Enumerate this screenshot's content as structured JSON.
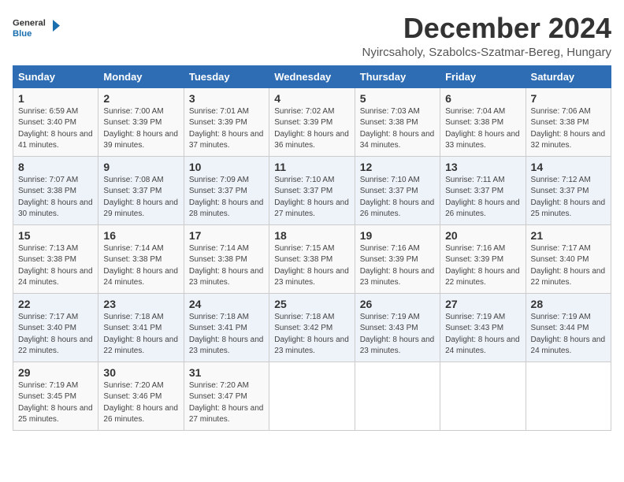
{
  "logo": {
    "general": "General",
    "blue": "Blue"
  },
  "title": "December 2024",
  "location": "Nyircsaholy, Szabolcs-Szatmar-Bereg, Hungary",
  "days_of_week": [
    "Sunday",
    "Monday",
    "Tuesday",
    "Wednesday",
    "Thursday",
    "Friday",
    "Saturday"
  ],
  "weeks": [
    [
      {
        "day": "1",
        "sunrise": "6:59 AM",
        "sunset": "3:40 PM",
        "daylight": "8 hours and 41 minutes."
      },
      {
        "day": "2",
        "sunrise": "7:00 AM",
        "sunset": "3:39 PM",
        "daylight": "8 hours and 39 minutes."
      },
      {
        "day": "3",
        "sunrise": "7:01 AM",
        "sunset": "3:39 PM",
        "daylight": "8 hours and 37 minutes."
      },
      {
        "day": "4",
        "sunrise": "7:02 AM",
        "sunset": "3:39 PM",
        "daylight": "8 hours and 36 minutes."
      },
      {
        "day": "5",
        "sunrise": "7:03 AM",
        "sunset": "3:38 PM",
        "daylight": "8 hours and 34 minutes."
      },
      {
        "day": "6",
        "sunrise": "7:04 AM",
        "sunset": "3:38 PM",
        "daylight": "8 hours and 33 minutes."
      },
      {
        "day": "7",
        "sunrise": "7:06 AM",
        "sunset": "3:38 PM",
        "daylight": "8 hours and 32 minutes."
      }
    ],
    [
      {
        "day": "8",
        "sunrise": "7:07 AM",
        "sunset": "3:38 PM",
        "daylight": "8 hours and 30 minutes."
      },
      {
        "day": "9",
        "sunrise": "7:08 AM",
        "sunset": "3:37 PM",
        "daylight": "8 hours and 29 minutes."
      },
      {
        "day": "10",
        "sunrise": "7:09 AM",
        "sunset": "3:37 PM",
        "daylight": "8 hours and 28 minutes."
      },
      {
        "day": "11",
        "sunrise": "7:10 AM",
        "sunset": "3:37 PM",
        "daylight": "8 hours and 27 minutes."
      },
      {
        "day": "12",
        "sunrise": "7:10 AM",
        "sunset": "3:37 PM",
        "daylight": "8 hours and 26 minutes."
      },
      {
        "day": "13",
        "sunrise": "7:11 AM",
        "sunset": "3:37 PM",
        "daylight": "8 hours and 26 minutes."
      },
      {
        "day": "14",
        "sunrise": "7:12 AM",
        "sunset": "3:37 PM",
        "daylight": "8 hours and 25 minutes."
      }
    ],
    [
      {
        "day": "15",
        "sunrise": "7:13 AM",
        "sunset": "3:38 PM",
        "daylight": "8 hours and 24 minutes."
      },
      {
        "day": "16",
        "sunrise": "7:14 AM",
        "sunset": "3:38 PM",
        "daylight": "8 hours and 24 minutes."
      },
      {
        "day": "17",
        "sunrise": "7:14 AM",
        "sunset": "3:38 PM",
        "daylight": "8 hours and 23 minutes."
      },
      {
        "day": "18",
        "sunrise": "7:15 AM",
        "sunset": "3:38 PM",
        "daylight": "8 hours and 23 minutes."
      },
      {
        "day": "19",
        "sunrise": "7:16 AM",
        "sunset": "3:39 PM",
        "daylight": "8 hours and 23 minutes."
      },
      {
        "day": "20",
        "sunrise": "7:16 AM",
        "sunset": "3:39 PM",
        "daylight": "8 hours and 22 minutes."
      },
      {
        "day": "21",
        "sunrise": "7:17 AM",
        "sunset": "3:40 PM",
        "daylight": "8 hours and 22 minutes."
      }
    ],
    [
      {
        "day": "22",
        "sunrise": "7:17 AM",
        "sunset": "3:40 PM",
        "daylight": "8 hours and 22 minutes."
      },
      {
        "day": "23",
        "sunrise": "7:18 AM",
        "sunset": "3:41 PM",
        "daylight": "8 hours and 22 minutes."
      },
      {
        "day": "24",
        "sunrise": "7:18 AM",
        "sunset": "3:41 PM",
        "daylight": "8 hours and 23 minutes."
      },
      {
        "day": "25",
        "sunrise": "7:18 AM",
        "sunset": "3:42 PM",
        "daylight": "8 hours and 23 minutes."
      },
      {
        "day": "26",
        "sunrise": "7:19 AM",
        "sunset": "3:43 PM",
        "daylight": "8 hours and 23 minutes."
      },
      {
        "day": "27",
        "sunrise": "7:19 AM",
        "sunset": "3:43 PM",
        "daylight": "8 hours and 24 minutes."
      },
      {
        "day": "28",
        "sunrise": "7:19 AM",
        "sunset": "3:44 PM",
        "daylight": "8 hours and 24 minutes."
      }
    ],
    [
      {
        "day": "29",
        "sunrise": "7:19 AM",
        "sunset": "3:45 PM",
        "daylight": "8 hours and 25 minutes."
      },
      {
        "day": "30",
        "sunrise": "7:20 AM",
        "sunset": "3:46 PM",
        "daylight": "8 hours and 26 minutes."
      },
      {
        "day": "31",
        "sunrise": "7:20 AM",
        "sunset": "3:47 PM",
        "daylight": "8 hours and 27 minutes."
      },
      null,
      null,
      null,
      null
    ]
  ]
}
